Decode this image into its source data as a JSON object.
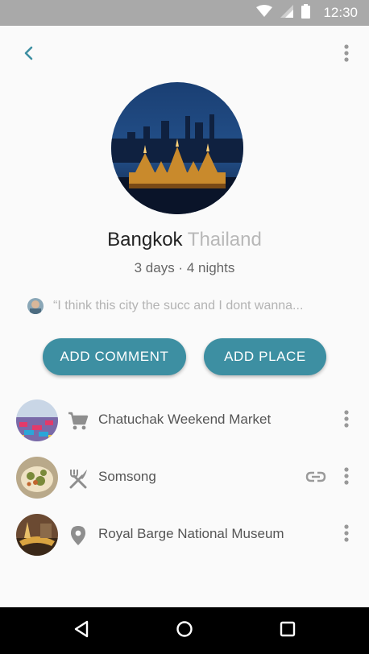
{
  "status_bar": {
    "time": "12:30",
    "icons": [
      "wifi-icon",
      "signal-icon",
      "battery-icon"
    ]
  },
  "header": {
    "back_icon": "chevron-left-icon",
    "menu_icon": "more-vert-icon"
  },
  "destination": {
    "city": "Bangkok",
    "country": "Thailand",
    "duration": "3 days · 4 nights",
    "quote": "“I think this city the succ and I dont wanna..."
  },
  "actions": {
    "add_comment": "ADD COMMENT",
    "add_place": "ADD PLACE"
  },
  "places": [
    {
      "name": "Chatuchak Weekend Market",
      "category_icon": "cart-icon",
      "has_link": false
    },
    {
      "name": "Somsong",
      "category_icon": "restaurant-icon",
      "has_link": true
    },
    {
      "name": "Royal Barge National Museum",
      "category_icon": "place-pin-icon",
      "has_link": false
    }
  ],
  "colors": {
    "accent": "#3d8fa2",
    "status_bar": "#a9a9a9",
    "nav_bar": "#000000",
    "country": "#b8b8b8"
  },
  "nav": {
    "icons": [
      "back-triangle-icon",
      "home-circle-icon",
      "recents-square-icon"
    ]
  }
}
